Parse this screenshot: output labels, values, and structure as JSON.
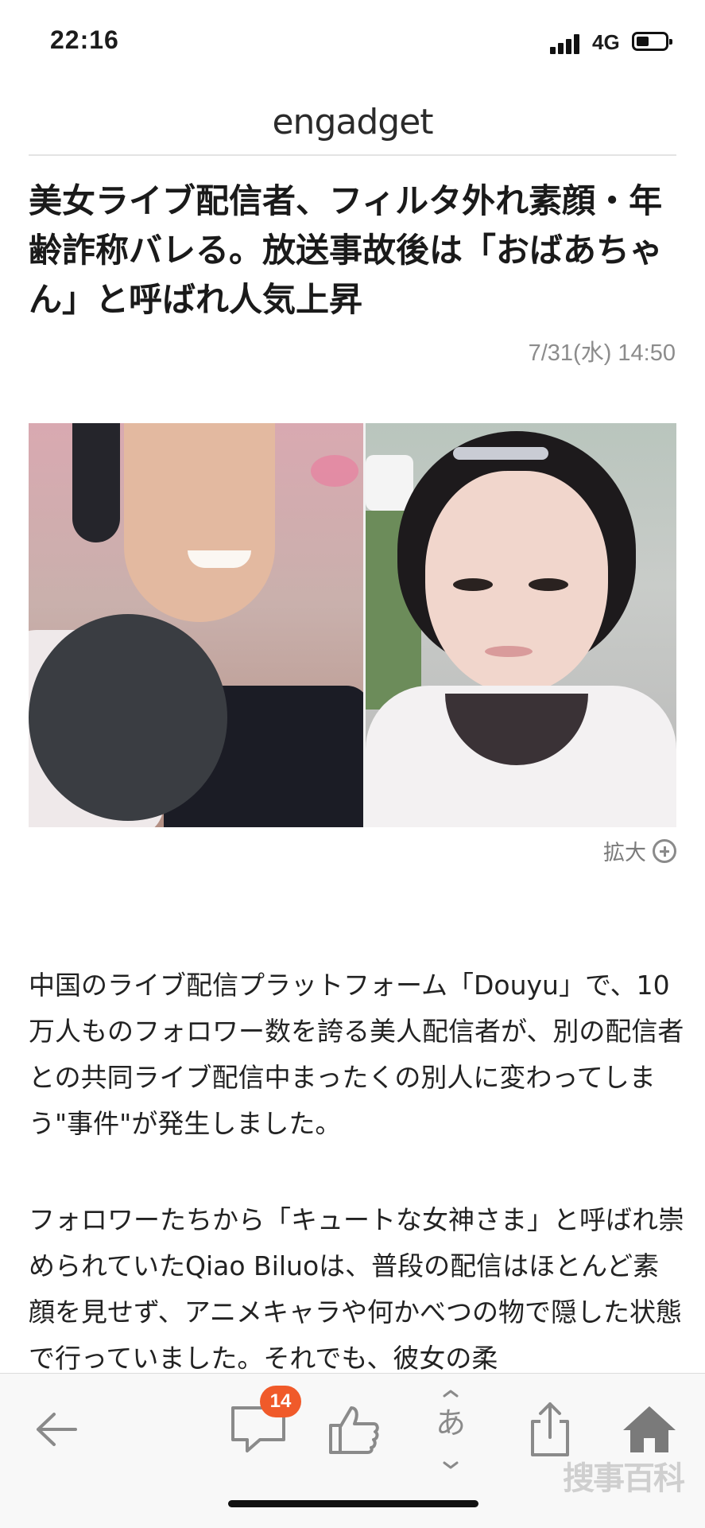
{
  "status_bar": {
    "time": "22:16",
    "network": "4G"
  },
  "header": {
    "logo": "engadget"
  },
  "article": {
    "headline": "美女ライブ配信者、フィルタ外れ素顔・年齢詐称バレる。放送事故後は「おばあちゃん」と呼ばれ人気上昇",
    "date": "7/31(水) 14:50",
    "zoom_label": "拡大",
    "paragraph1": "中国のライブ配信プラットフォーム「Douyu」で、10万人ものフォロワー数を誇る美人配信者が、別の配信者との共同ライブ配信中まったくの別人に変わってしまう\"事件\"が発生しました。",
    "paragraph2": "フォロワーたちから「キュートな女神さま」と呼ばれ崇められていたQiao Biluoは、普段の配信はほとんど素顔を見せず、アニメキャラや何かべつの物で隠した状態で行っていました。それでも、彼女の柔"
  },
  "toolbar": {
    "comment_count": "14",
    "font_label": "あ",
    "icons": [
      "back-arrow-icon",
      "comment-icon",
      "thumbs-up-icon",
      "font-size-icon",
      "share-icon",
      "home-icon"
    ]
  },
  "watermark": "搜事百科"
}
